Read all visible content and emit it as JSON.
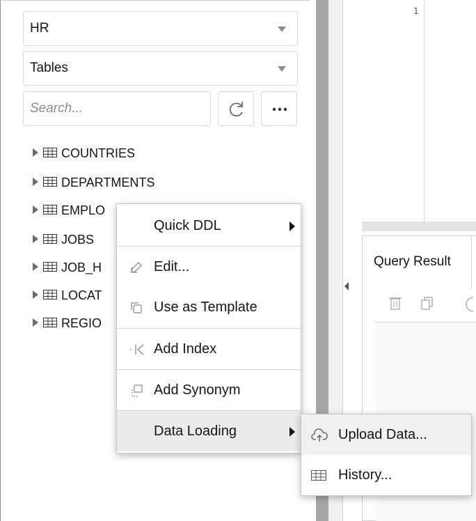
{
  "navigator": {
    "schema_select": "HR",
    "object_type_select": "Tables",
    "search": {
      "placeholder": "Search..."
    },
    "tree": [
      {
        "label": "COUNTRIES"
      },
      {
        "label": "DEPARTMENTS"
      },
      {
        "label": "EMPLO"
      },
      {
        "label": "JOBS"
      },
      {
        "label": "JOB_H"
      },
      {
        "label": "LOCAT"
      },
      {
        "label": "REGIO"
      }
    ]
  },
  "editor": {
    "line_number": "1"
  },
  "results": {
    "tab_label": "Query Result"
  },
  "context_menu": {
    "items": [
      {
        "label": "Quick DDL",
        "icon": "none",
        "submenu": true
      },
      {
        "label": "Edit...",
        "icon": "pencil-icon"
      },
      {
        "label": "Use as Template",
        "icon": "copy-icon"
      },
      {
        "label": "Add Index",
        "icon": "index-arrow-icon"
      },
      {
        "label": "Add Synonym",
        "icon": "synonym-icon"
      },
      {
        "label": "Data Loading",
        "icon": "none",
        "submenu": true
      }
    ]
  },
  "submenu": {
    "items": [
      {
        "label": "Upload Data...",
        "icon": "cloud-upload-icon"
      },
      {
        "label": "History...",
        "icon": "table-icon"
      }
    ]
  },
  "colors": {
    "splitter": "#a7a7a7",
    "menu_highlight": "#ebebeb",
    "text": "#161513"
  }
}
